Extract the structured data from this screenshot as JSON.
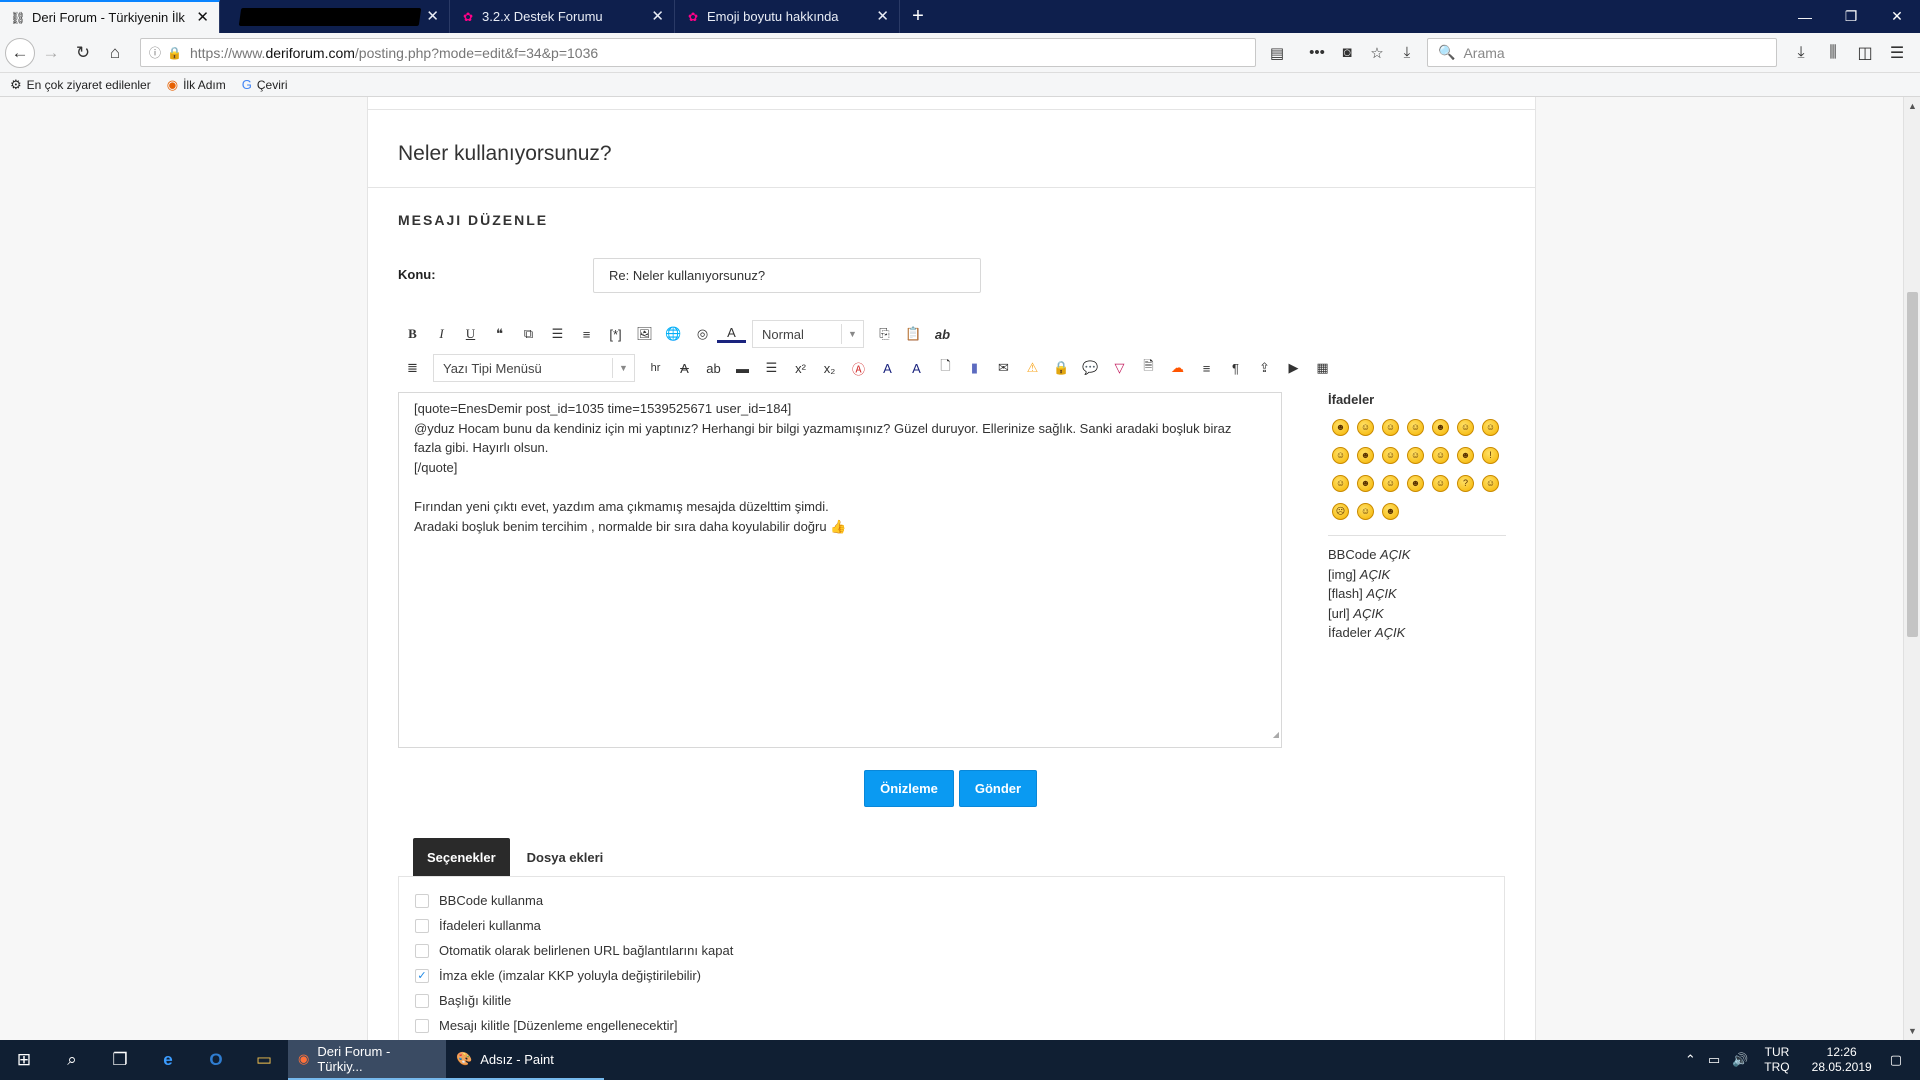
{
  "browser": {
    "tabs": [
      {
        "title": "Deri Forum - Türkiyenin İlk ve T",
        "active": true
      },
      {
        "title": "",
        "active": false
      },
      {
        "title": "3.2.x Destek Forumu",
        "active": false
      },
      {
        "title": "Emoji boyutu hakkında",
        "active": false
      }
    ],
    "new_tab": "+",
    "url_prefix": "https://www.",
    "url_domain": "deriforum.com",
    "url_path": "/posting.php?mode=edit&f=34&p=1036",
    "search_placeholder": "Arama",
    "bookmarks": [
      {
        "label": "En çok ziyaret edilenler",
        "icon": "gear-icon"
      },
      {
        "label": "İlk Adım",
        "icon": "firefox-icon"
      },
      {
        "label": "Çeviri",
        "icon": "translate-icon"
      }
    ]
  },
  "page": {
    "topic_title": "Neler kullanıyorsunuz?",
    "section_title": "MESAJI DÜZENLE",
    "subject_label": "Konu:",
    "subject_value": "Re: Neler kullanıyorsunuz?",
    "size_select": "Normal",
    "font_select": "Yazı Tipi Menüsü",
    "hr_label": "hr",
    "message_text": "[quote=EnesDemir post_id=1035 time=1539525671 user_id=184]\n@yduz Hocam bunu da kendiniz için mi yaptınız? Herhangi bir bilgi yazmamışınız? Güzel duruyor. Ellerinize sağlık. Sanki aradaki boşluk biraz\nfazla gibi. Hayırlı olsun.\n[/quote]\n\nFırından yeni çıktı evet, yazdım ama çıkmamış mesajda düzelttim şimdi.\nAradaki boşluk benim tercihim , normalde bir sıra daha koyulabilir doğru 👍",
    "smilies_title": "İfadeler",
    "smilies_count": 24,
    "bbcode_status": [
      {
        "label": "BBCode",
        "state": "AÇIK"
      },
      {
        "label": "[img]",
        "state": "AÇIK"
      },
      {
        "label": "[flash]",
        "state": "AÇIK"
      },
      {
        "label": "[url]",
        "state": "AÇIK"
      },
      {
        "label": "İfadeler",
        "state": "AÇIK"
      }
    ],
    "preview_button": "Önizleme",
    "submit_button": "Gönder",
    "tabs": [
      "Seçenekler",
      "Dosya ekleri"
    ],
    "options": [
      {
        "label": "BBCode kullanma",
        "checked": false
      },
      {
        "label": "İfadeleri kullanma",
        "checked": false
      },
      {
        "label": "Otomatik olarak belirlenen URL bağlantılarını kapat",
        "checked": false
      },
      {
        "label": "İmza ekle (imzalar KKP yoluyla değiştirilebilir)",
        "checked": true
      },
      {
        "label": "Başlığı kilitle",
        "checked": false
      },
      {
        "label": "Mesajı kilitle [Düzenleme engellenecektir]",
        "checked": false
      }
    ]
  },
  "taskbar": {
    "apps": [
      {
        "label": "Deri Forum - Türkiy...",
        "active": true
      },
      {
        "label": "Adsız - Paint",
        "active": false
      }
    ],
    "lang_top": "TUR",
    "lang_bottom": "TRQ",
    "time": "12:26",
    "date": "28.05.2019"
  },
  "colors": {
    "accent": "#0a9af2",
    "tabbar": "#0e1f4d",
    "taskbar": "#101f33"
  }
}
